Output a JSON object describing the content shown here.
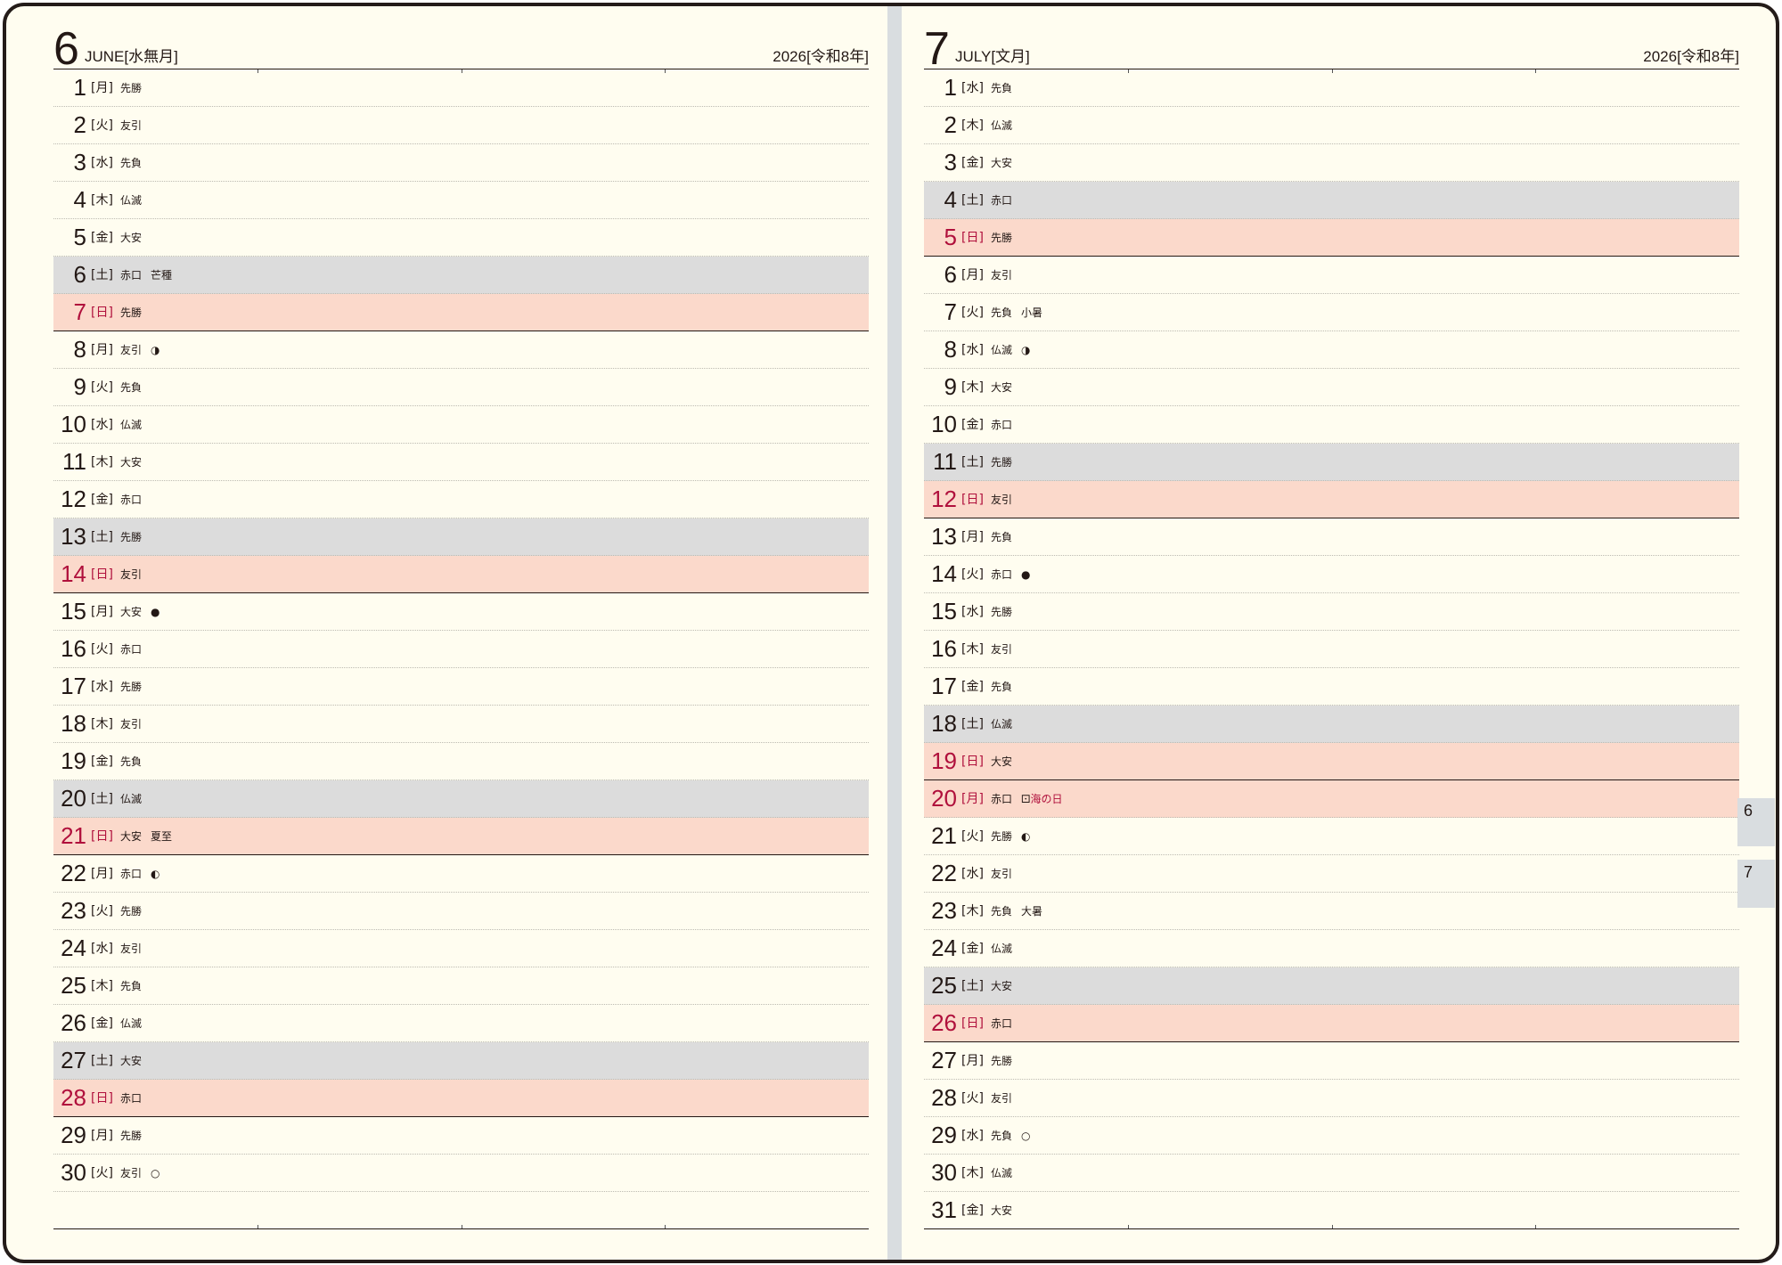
{
  "pages": [
    {
      "month_num": "6",
      "month_name": "JUNE",
      "month_jp": "[水無月]",
      "year": "2026[令和8年]",
      "days": [
        {
          "d": "1",
          "w": "[月]",
          "r": "先勝",
          "x": "",
          "type": "weekday"
        },
        {
          "d": "2",
          "w": "[火]",
          "r": "友引",
          "x": "",
          "type": "weekday"
        },
        {
          "d": "3",
          "w": "[水]",
          "r": "先負",
          "x": "",
          "type": "weekday"
        },
        {
          "d": "4",
          "w": "[木]",
          "r": "仏滅",
          "x": "",
          "type": "weekday"
        },
        {
          "d": "5",
          "w": "[金]",
          "r": "大安",
          "x": "",
          "type": "weekday"
        },
        {
          "d": "6",
          "w": "[土]",
          "r": "赤口",
          "x": "芒種",
          "type": "sat"
        },
        {
          "d": "7",
          "w": "[日]",
          "r": "先勝",
          "x": "",
          "type": "sun"
        },
        {
          "d": "8",
          "w": "[月]",
          "r": "友引",
          "x": "◑",
          "type": "weekday"
        },
        {
          "d": "9",
          "w": "[火]",
          "r": "先負",
          "x": "",
          "type": "weekday"
        },
        {
          "d": "10",
          "w": "[水]",
          "r": "仏滅",
          "x": "",
          "type": "weekday"
        },
        {
          "d": "11",
          "w": "[木]",
          "r": "大安",
          "x": "",
          "type": "weekday"
        },
        {
          "d": "12",
          "w": "[金]",
          "r": "赤口",
          "x": "",
          "type": "weekday"
        },
        {
          "d": "13",
          "w": "[土]",
          "r": "先勝",
          "x": "",
          "type": "sat"
        },
        {
          "d": "14",
          "w": "[日]",
          "r": "友引",
          "x": "",
          "type": "sun"
        },
        {
          "d": "15",
          "w": "[月]",
          "r": "大安",
          "x": "●",
          "type": "weekday"
        },
        {
          "d": "16",
          "w": "[火]",
          "r": "赤口",
          "x": "",
          "type": "weekday"
        },
        {
          "d": "17",
          "w": "[水]",
          "r": "先勝",
          "x": "",
          "type": "weekday"
        },
        {
          "d": "18",
          "w": "[木]",
          "r": "友引",
          "x": "",
          "type": "weekday"
        },
        {
          "d": "19",
          "w": "[金]",
          "r": "先負",
          "x": "",
          "type": "weekday"
        },
        {
          "d": "20",
          "w": "[土]",
          "r": "仏滅",
          "x": "",
          "type": "sat"
        },
        {
          "d": "21",
          "w": "[日]",
          "r": "大安",
          "x": "夏至",
          "type": "sun"
        },
        {
          "d": "22",
          "w": "[月]",
          "r": "赤口",
          "x": "◐",
          "type": "weekday"
        },
        {
          "d": "23",
          "w": "[火]",
          "r": "先勝",
          "x": "",
          "type": "weekday"
        },
        {
          "d": "24",
          "w": "[水]",
          "r": "友引",
          "x": "",
          "type": "weekday"
        },
        {
          "d": "25",
          "w": "[木]",
          "r": "先負",
          "x": "",
          "type": "weekday"
        },
        {
          "d": "26",
          "w": "[金]",
          "r": "仏滅",
          "x": "",
          "type": "weekday"
        },
        {
          "d": "27",
          "w": "[土]",
          "r": "大安",
          "x": "",
          "type": "sat"
        },
        {
          "d": "28",
          "w": "[日]",
          "r": "赤口",
          "x": "",
          "type": "sun"
        },
        {
          "d": "29",
          "w": "[月]",
          "r": "先勝",
          "x": "",
          "type": "weekday"
        },
        {
          "d": "30",
          "w": "[火]",
          "r": "友引",
          "x": "○",
          "type": "weekday"
        },
        {
          "d": "",
          "w": "",
          "r": "",
          "x": "",
          "type": "blank"
        }
      ]
    },
    {
      "month_num": "7",
      "month_name": "JULY",
      "month_jp": "[文月]",
      "year": "2026[令和8年]",
      "days": [
        {
          "d": "1",
          "w": "[水]",
          "r": "先負",
          "x": "",
          "type": "weekday"
        },
        {
          "d": "2",
          "w": "[木]",
          "r": "仏滅",
          "x": "",
          "type": "weekday"
        },
        {
          "d": "3",
          "w": "[金]",
          "r": "大安",
          "x": "",
          "type": "weekday"
        },
        {
          "d": "4",
          "w": "[土]",
          "r": "赤口",
          "x": "",
          "type": "sat"
        },
        {
          "d": "5",
          "w": "[日]",
          "r": "先勝",
          "x": "",
          "type": "sun"
        },
        {
          "d": "6",
          "w": "[月]",
          "r": "友引",
          "x": "",
          "type": "weekday"
        },
        {
          "d": "7",
          "w": "[火]",
          "r": "先負",
          "x": "小暑",
          "type": "weekday"
        },
        {
          "d": "8",
          "w": "[水]",
          "r": "仏滅",
          "x": "◑",
          "type": "weekday"
        },
        {
          "d": "9",
          "w": "[木]",
          "r": "大安",
          "x": "",
          "type": "weekday"
        },
        {
          "d": "10",
          "w": "[金]",
          "r": "赤口",
          "x": "",
          "type": "weekday"
        },
        {
          "d": "11",
          "w": "[土]",
          "r": "先勝",
          "x": "",
          "type": "sat"
        },
        {
          "d": "12",
          "w": "[日]",
          "r": "友引",
          "x": "",
          "type": "sun"
        },
        {
          "d": "13",
          "w": "[月]",
          "r": "先負",
          "x": "",
          "type": "weekday"
        },
        {
          "d": "14",
          "w": "[火]",
          "r": "赤口",
          "x": "●",
          "type": "weekday"
        },
        {
          "d": "15",
          "w": "[水]",
          "r": "先勝",
          "x": "",
          "type": "weekday"
        },
        {
          "d": "16",
          "w": "[木]",
          "r": "友引",
          "x": "",
          "type": "weekday"
        },
        {
          "d": "17",
          "w": "[金]",
          "r": "先負",
          "x": "",
          "type": "weekday"
        },
        {
          "d": "18",
          "w": "[土]",
          "r": "仏滅",
          "x": "",
          "type": "sat"
        },
        {
          "d": "19",
          "w": "[日]",
          "r": "大安",
          "x": "",
          "type": "sun"
        },
        {
          "d": "20",
          "w": "[月]",
          "r": "赤口",
          "x": "",
          "holiday_mark": "⚀",
          "holiday": "海の日",
          "type": "holiday"
        },
        {
          "d": "21",
          "w": "[火]",
          "r": "先勝",
          "x": "◐",
          "type": "weekday"
        },
        {
          "d": "22",
          "w": "[水]",
          "r": "友引",
          "x": "",
          "type": "weekday"
        },
        {
          "d": "23",
          "w": "[木]",
          "r": "先負",
          "x": "大暑",
          "type": "weekday"
        },
        {
          "d": "24",
          "w": "[金]",
          "r": "仏滅",
          "x": "",
          "type": "weekday"
        },
        {
          "d": "25",
          "w": "[土]",
          "r": "大安",
          "x": "",
          "type": "sat"
        },
        {
          "d": "26",
          "w": "[日]",
          "r": "赤口",
          "x": "",
          "type": "sun"
        },
        {
          "d": "27",
          "w": "[月]",
          "r": "先勝",
          "x": "",
          "type": "weekday"
        },
        {
          "d": "28",
          "w": "[火]",
          "r": "友引",
          "x": "",
          "type": "weekday"
        },
        {
          "d": "29",
          "w": "[水]",
          "r": "先負",
          "x": "○",
          "type": "weekday"
        },
        {
          "d": "30",
          "w": "[木]",
          "r": "仏滅",
          "x": "",
          "type": "weekday"
        },
        {
          "d": "31",
          "w": "[金]",
          "r": "大安",
          "x": "",
          "type": "weekday"
        }
      ]
    }
  ],
  "side_tabs": [
    "6",
    "7"
  ],
  "colors": {
    "sun_text": "#b0103c",
    "sun_bg": "#fbd9cb",
    "sat_bg": "#dcdcdc",
    "paper": "#fffdf0"
  }
}
